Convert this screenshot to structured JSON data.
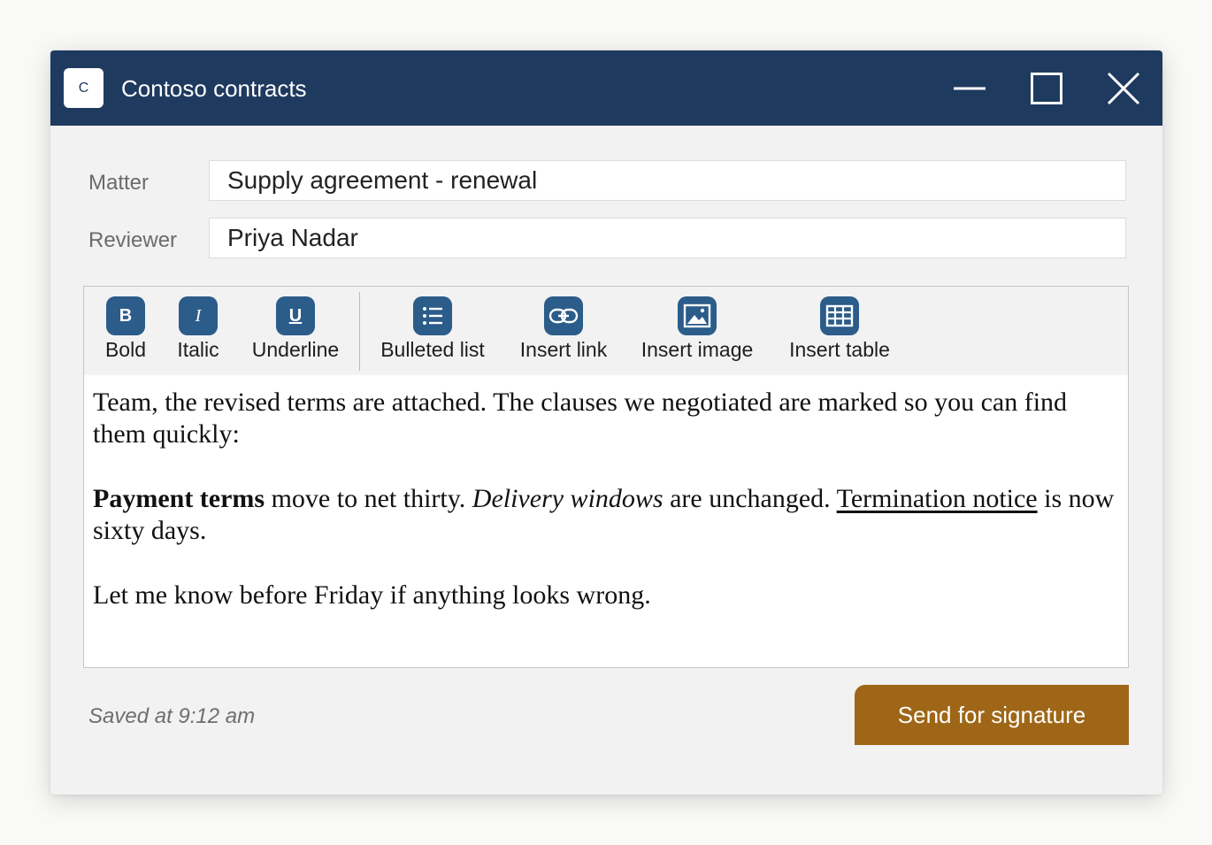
{
  "window": {
    "app_badge": "C",
    "title": "Contoso contracts"
  },
  "fields": {
    "matter_label": "Matter",
    "matter_value": "Supply agreement - renewal",
    "reviewer_label": "Reviewer",
    "reviewer_value": "Priya Nadar"
  },
  "toolbar": {
    "bold": {
      "glyph": "B",
      "label": "Bold"
    },
    "italic": {
      "glyph": "I",
      "label": "Italic"
    },
    "underline": {
      "glyph": "U",
      "label": "Underline"
    },
    "bulleted_list": {
      "icon": "list-icon",
      "label": "Bulleted list"
    },
    "insert_link": {
      "icon": "link-icon",
      "label": "Insert link"
    },
    "insert_image": {
      "icon": "image-icon",
      "label": "Insert image"
    },
    "insert_table": {
      "icon": "table-icon",
      "label": "Insert table"
    }
  },
  "body": {
    "p1": "Team, the revised terms are attached. The clauses we negotiated are marked so you can find them quickly:",
    "p2_bold": "Payment terms",
    "p2_a": " move to net thirty. ",
    "p2_italic": "Delivery windows",
    "p2_b": " are unchanged. ",
    "p2_underline": "Termination notice",
    "p2_c": " is now sixty days.",
    "p3": "Let me know before Friday if anything looks wrong."
  },
  "footer": {
    "saved_status": "Saved at 9:12 am",
    "send_label": "Send for signature"
  },
  "colors": {
    "titlebar": "#1f3a5f",
    "toolbar_icon": "#2b5c8a",
    "send_button": "#9e6616"
  }
}
